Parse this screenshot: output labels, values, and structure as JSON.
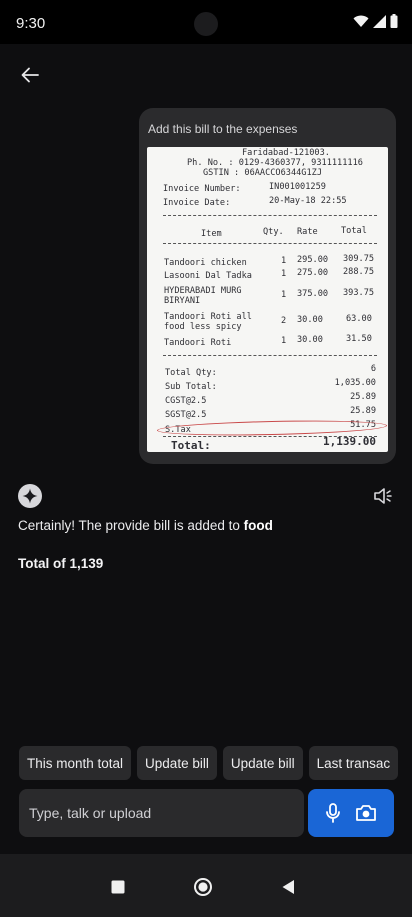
{
  "status_bar": {
    "time": "9:30",
    "icons": [
      "wifi-icon",
      "signal-icon",
      "battery-icon"
    ]
  },
  "header": {
    "back_icon": "arrow-left-icon"
  },
  "user_message": {
    "text": "Add this bill to the expenses",
    "attachment": {
      "type": "receipt-photo",
      "header_lines": [
        "Faridabad-121003.",
        "Ph. No. : 0129-4360377, 9311111116",
        "GSTIN : 06AACCO6344G1ZJ"
      ],
      "invoice_number_label": "Invoice Number:",
      "invoice_number": "IN001001259",
      "invoice_date_label": "Invoice Date:",
      "invoice_date": "20-May-18 22:55",
      "columns": [
        "Item",
        "Qty.",
        "Rate",
        "Total"
      ],
      "items": [
        {
          "name": "Tandoori chicken",
          "qty": "1",
          "rate": "295.00",
          "total": "309.75"
        },
        {
          "name": "Lasooni Dal Tadka",
          "qty": "1",
          "rate": "275.00",
          "total": "288.75"
        },
        {
          "name": "HYDERABADI MURG BIRYANI",
          "qty": "1",
          "rate": "375.00",
          "total": "393.75"
        },
        {
          "name": "Tandoori Roti all food less spicy",
          "qty": "2",
          "rate": "30.00",
          "total": "63.00"
        },
        {
          "name": "Tandoori Roti",
          "qty": "1",
          "rate": "30.00",
          "total": "31.50"
        }
      ],
      "summary": [
        {
          "label": "Total Qty:",
          "value": "6"
        },
        {
          "label": "Sub Total:",
          "value": "1,035.00"
        },
        {
          "label": "CGST@2.5",
          "value": "25.89"
        },
        {
          "label": "SGST@2.5",
          "value": "25.89"
        },
        {
          "label": "S.Tax",
          "value": "51.75"
        }
      ],
      "grand_total_label": "Total:",
      "grand_total": "1,139.00"
    }
  },
  "assistant": {
    "avatar_icon": "sparkle-icon",
    "speaker_icon": "speaker-icon",
    "reply_prefix": "Certainly! The provide bill is added to ",
    "reply_category": "food",
    "total_line": "Total of 1,139"
  },
  "suggestions": [
    "This month total",
    "Update bill",
    "Update bill",
    "Last transac"
  ],
  "composer": {
    "placeholder": "Type, talk or upload",
    "value": "",
    "mic_icon": "microphone-icon",
    "camera_icon": "camera-icon"
  },
  "nav_bar": {
    "icons": [
      "recents-square-icon",
      "home-circle-icon",
      "back-triangle-icon"
    ]
  },
  "colors": {
    "background": "#0e0e10",
    "bubble": "#2b2b2d",
    "chip": "#2a2a2c",
    "accent": "#1a66d6",
    "highlight": "#c94a4a"
  }
}
